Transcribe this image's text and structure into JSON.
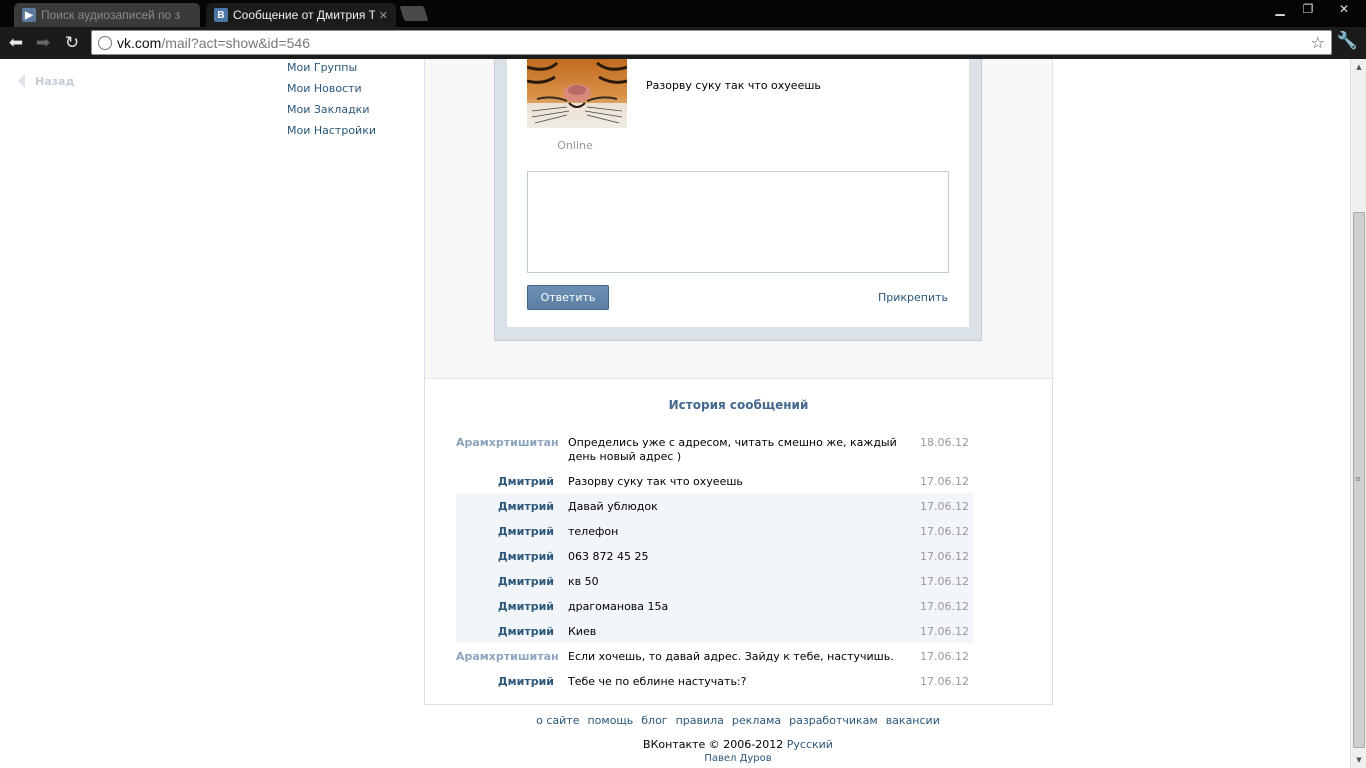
{
  "browser": {
    "tabs": [
      {
        "title": "Поиск аудиозаписей по з",
        "active": false,
        "favicon": "▶"
      },
      {
        "title": "Сообщение от Дмитрия Т",
        "active": true,
        "favicon": "B"
      }
    ],
    "close_glyph": "✕",
    "url_host": "vk.com",
    "url_path": "/mail?act=show&id=546"
  },
  "page": {
    "back_label": "Назад",
    "left_menu": [
      "Мои Группы",
      "Мои Новости",
      "Мои Закладки",
      "Мои Настройки"
    ],
    "message": {
      "status": "Online",
      "text": "Разорву суку так что охуеешь"
    },
    "reply_button": "Ответить",
    "attach_label": "Прикрепить",
    "history_title": "История сообщений",
    "history": [
      {
        "author": "Арамхртишитан",
        "me": true,
        "text": "Определись уже с адресом, читать смешно же, каждый день новый адрес )",
        "date": "18.06.12",
        "alt": false
      },
      {
        "author": "Дмитрий",
        "me": false,
        "text": "Разорву суку так что охуеешь",
        "date": "17.06.12",
        "alt": false
      },
      {
        "author": "Дмитрий",
        "me": false,
        "text": "Давай ублюдок",
        "date": "17.06.12",
        "alt": true
      },
      {
        "author": "Дмитрий",
        "me": false,
        "text": "телефон",
        "date": "17.06.12",
        "alt": true
      },
      {
        "author": "Дмитрий",
        "me": false,
        "text": "063 872 45 25",
        "date": "17.06.12",
        "alt": true
      },
      {
        "author": "Дмитрий",
        "me": false,
        "text": "кв 50",
        "date": "17.06.12",
        "alt": true
      },
      {
        "author": "Дмитрий",
        "me": false,
        "text": "драгоманова 15а",
        "date": "17.06.12",
        "alt": true
      },
      {
        "author": "Дмитрий",
        "me": false,
        "text": "Киев",
        "date": "17.06.12",
        "alt": true
      },
      {
        "author": "Арамхртишитан",
        "me": true,
        "text": "Если хочешь, то давай адрес. Зайду к тебе, настучишь.",
        "date": "17.06.12",
        "alt": false
      },
      {
        "author": "Дмитрий",
        "me": false,
        "text": "Тебе че по еблине настучать:?",
        "date": "17.06.12",
        "alt": false
      }
    ],
    "footer": {
      "links": [
        "о сайте",
        "помощь",
        "блог",
        "правила",
        "реклама",
        "разработчикам",
        "вакансии"
      ],
      "copyright": "ВКонтакте © 2006-2012",
      "language": "Русский",
      "author": "Павел Дуров"
    }
  },
  "colors": {
    "link": "#2b587a",
    "accent": "#45688e",
    "button": "#5b7ea4"
  }
}
